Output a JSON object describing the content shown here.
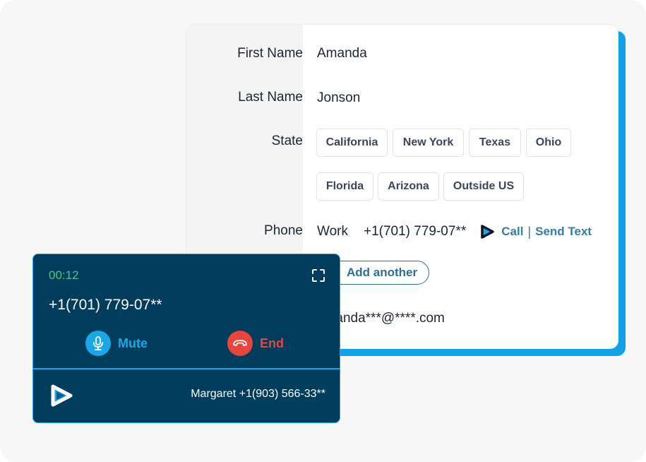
{
  "form": {
    "fields": [
      {
        "label": "First Name",
        "value": "Amanda"
      },
      {
        "label": "Last Name",
        "value": "Jonson"
      },
      {
        "label": "State"
      },
      {
        "label": "Phone"
      }
    ],
    "states": [
      "California",
      "New York",
      "Texas",
      "Ohio",
      "Florida",
      "Arizona",
      "Outside US"
    ],
    "phone": {
      "type": "Work",
      "number": "+1(701) 779-07**",
      "call_label": "Call",
      "separator": "|",
      "text_label": "Send Text",
      "logo_icon": "play-logo-icon"
    },
    "add_another_label": "Add another",
    "email": "amanda***@****.com"
  },
  "call_widget": {
    "timer": "00:12",
    "number": "+1(701) 779-07**",
    "mute_label": "Mute",
    "end_label": "End",
    "caller": "Margaret +1(903) 566-33**",
    "colors": {
      "timer": "#4cc48a",
      "mute": "#1aa7e8",
      "end": "#e8453c",
      "panel": "#003d5c"
    }
  },
  "accent_color": "#10a2e6"
}
